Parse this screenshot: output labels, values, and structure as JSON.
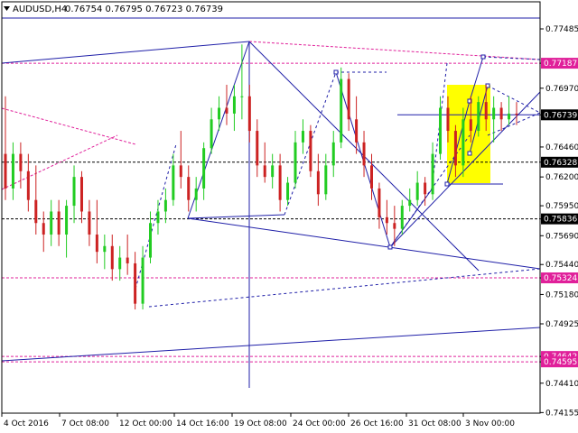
{
  "header": {
    "symbol": "AUDUSD,H4",
    "ohlc": "0.76754 0.76795 0.76723 0.76739",
    "menu_icon": "triangle-down-icon"
  },
  "colors": {
    "bull": "#22cc22",
    "bear": "#cc2222",
    "drawing": "#1f1fa8",
    "level_magenta": "#e0209a",
    "highlight": "#ffff00",
    "price_badge": "#000000"
  },
  "chart_data": {
    "type": "candlestick",
    "instrument": "AUDUSD",
    "timeframe": "H4",
    "ylim": [
      0.7415,
      0.7772
    ],
    "y_ticks": [
      "0.77485",
      "0.77187",
      "0.76970",
      "0.76739",
      "0.76460",
      "0.76328",
      "0.76200",
      "0.75950",
      "0.75836",
      "0.75690",
      "0.75440",
      "0.75324",
      "0.75180",
      "0.74925",
      "0.74642",
      "0.74595",
      "0.74410",
      "0.74155"
    ],
    "x_ticks": [
      "4 Oct 2016",
      "7 Oct 08:00",
      "12 Oct 00:00",
      "14 Oct 16:00",
      "19 Oct 08:00",
      "24 Oct 00:00",
      "26 Oct 16:00",
      "31 Oct 08:00",
      "3 Nov 00:00"
    ],
    "levels": [
      {
        "label": "0.77187",
        "value": 0.77187,
        "color": "#e0209a",
        "style": "dashed"
      },
      {
        "label": "0.76739",
        "value": 0.76739,
        "color": "#000000",
        "style": "current"
      },
      {
        "label": "0.76328",
        "value": 0.76328,
        "color": "#000000",
        "style": "dashed"
      },
      {
        "label": "0.75836",
        "value": 0.75836,
        "color": "#000000",
        "style": "dashed"
      },
      {
        "label": "0.75324",
        "value": 0.75324,
        "color": "#e0209a",
        "style": "dashed"
      },
      {
        "label": "0.74642",
        "value": 0.74642,
        "color": "#e0209a",
        "style": "dashed"
      },
      {
        "label": "0.74595",
        "value": 0.74595,
        "color": "#e0209a",
        "style": "dashed"
      }
    ],
    "candles": [
      [
        0.764,
        0.769,
        0.76,
        0.761
      ],
      [
        0.761,
        0.765,
        0.76,
        0.764
      ],
      [
        0.764,
        0.765,
        0.761,
        0.7625
      ],
      [
        0.7625,
        0.764,
        0.759,
        0.76
      ],
      [
        0.76,
        0.763,
        0.757,
        0.758
      ],
      [
        0.758,
        0.759,
        0.7555,
        0.757
      ],
      [
        0.757,
        0.76,
        0.756,
        0.759
      ],
      [
        0.759,
        0.76,
        0.756,
        0.757
      ],
      [
        0.757,
        0.76,
        0.755,
        0.7595
      ],
      [
        0.7595,
        0.763,
        0.758,
        0.762
      ],
      [
        0.762,
        0.7625,
        0.758,
        0.759
      ],
      [
        0.759,
        0.76,
        0.756,
        0.757
      ],
      [
        0.757,
        0.76,
        0.7545,
        0.7555
      ],
      [
        0.7555,
        0.757,
        0.754,
        0.756
      ],
      [
        0.756,
        0.757,
        0.753,
        0.754
      ],
      [
        0.754,
        0.756,
        0.753,
        0.755
      ],
      [
        0.755,
        0.757,
        0.7535,
        0.7545
      ],
      [
        0.7545,
        0.7555,
        0.7505,
        0.751
      ],
      [
        0.751,
        0.756,
        0.7505,
        0.755
      ],
      [
        0.755,
        0.759,
        0.7545,
        0.758
      ],
      [
        0.758,
        0.76,
        0.757,
        0.759
      ],
      [
        0.759,
        0.761,
        0.758,
        0.76
      ],
      [
        0.76,
        0.764,
        0.7595,
        0.763
      ],
      [
        0.763,
        0.766,
        0.761,
        0.762
      ],
      [
        0.762,
        0.763,
        0.759,
        0.76
      ],
      [
        0.76,
        0.762,
        0.759,
        0.761
      ],
      [
        0.761,
        0.765,
        0.76,
        0.7645
      ],
      [
        0.7645,
        0.768,
        0.764,
        0.767
      ],
      [
        0.767,
        0.769,
        0.766,
        0.768
      ],
      [
        0.768,
        0.77,
        0.7665,
        0.7675
      ],
      [
        0.7675,
        0.77,
        0.766,
        0.769
      ],
      [
        0.769,
        0.7735,
        0.767,
        0.769
      ],
      [
        0.769,
        0.77,
        0.765,
        0.766
      ],
      [
        0.766,
        0.767,
        0.762,
        0.763
      ],
      [
        0.763,
        0.765,
        0.7615,
        0.762
      ],
      [
        0.762,
        0.764,
        0.761,
        0.763
      ],
      [
        0.763,
        0.764,
        0.759,
        0.76
      ],
      [
        0.76,
        0.762,
        0.7595,
        0.7615
      ],
      [
        0.7615,
        0.766,
        0.761,
        0.765
      ],
      [
        0.765,
        0.767,
        0.764,
        0.766
      ],
      [
        0.766,
        0.7665,
        0.762,
        0.7625
      ],
      [
        0.7625,
        0.764,
        0.7595,
        0.7605
      ],
      [
        0.7605,
        0.764,
        0.76,
        0.763
      ],
      [
        0.763,
        0.766,
        0.762,
        0.765
      ],
      [
        0.765,
        0.7715,
        0.7645,
        0.7705
      ],
      [
        0.7705,
        0.771,
        0.766,
        0.767
      ],
      [
        0.767,
        0.769,
        0.764,
        0.765
      ],
      [
        0.765,
        0.766,
        0.762,
        0.763
      ],
      [
        0.763,
        0.764,
        0.76,
        0.761
      ],
      [
        0.761,
        0.7615,
        0.7575,
        0.7585
      ],
      [
        0.7585,
        0.76,
        0.757,
        0.758
      ],
      [
        0.758,
        0.7595,
        0.756,
        0.7575
      ],
      [
        0.7575,
        0.76,
        0.757,
        0.7595
      ],
      [
        0.7595,
        0.761,
        0.759,
        0.76
      ],
      [
        0.76,
        0.7625,
        0.7595,
        0.7615
      ],
      [
        0.7615,
        0.762,
        0.7595,
        0.7605
      ],
      [
        0.7605,
        0.765,
        0.76,
        0.764
      ],
      [
        0.764,
        0.769,
        0.7635,
        0.768
      ],
      [
        0.768,
        0.769,
        0.765,
        0.766
      ],
      [
        0.766,
        0.7665,
        0.762,
        0.763
      ],
      [
        0.763,
        0.768,
        0.762,
        0.767
      ],
      [
        0.767,
        0.769,
        0.765,
        0.766
      ],
      [
        0.766,
        0.769,
        0.7655,
        0.7685
      ],
      [
        0.7685,
        0.77,
        0.766,
        0.767
      ],
      [
        0.767,
        0.769,
        0.765,
        0.768
      ],
      [
        0.768,
        0.7685,
        0.766,
        0.767
      ],
      [
        0.767,
        0.769,
        0.7665,
        0.7675
      ],
      [
        0.7675,
        0.7685,
        0.7665,
        0.7674
      ]
    ]
  }
}
